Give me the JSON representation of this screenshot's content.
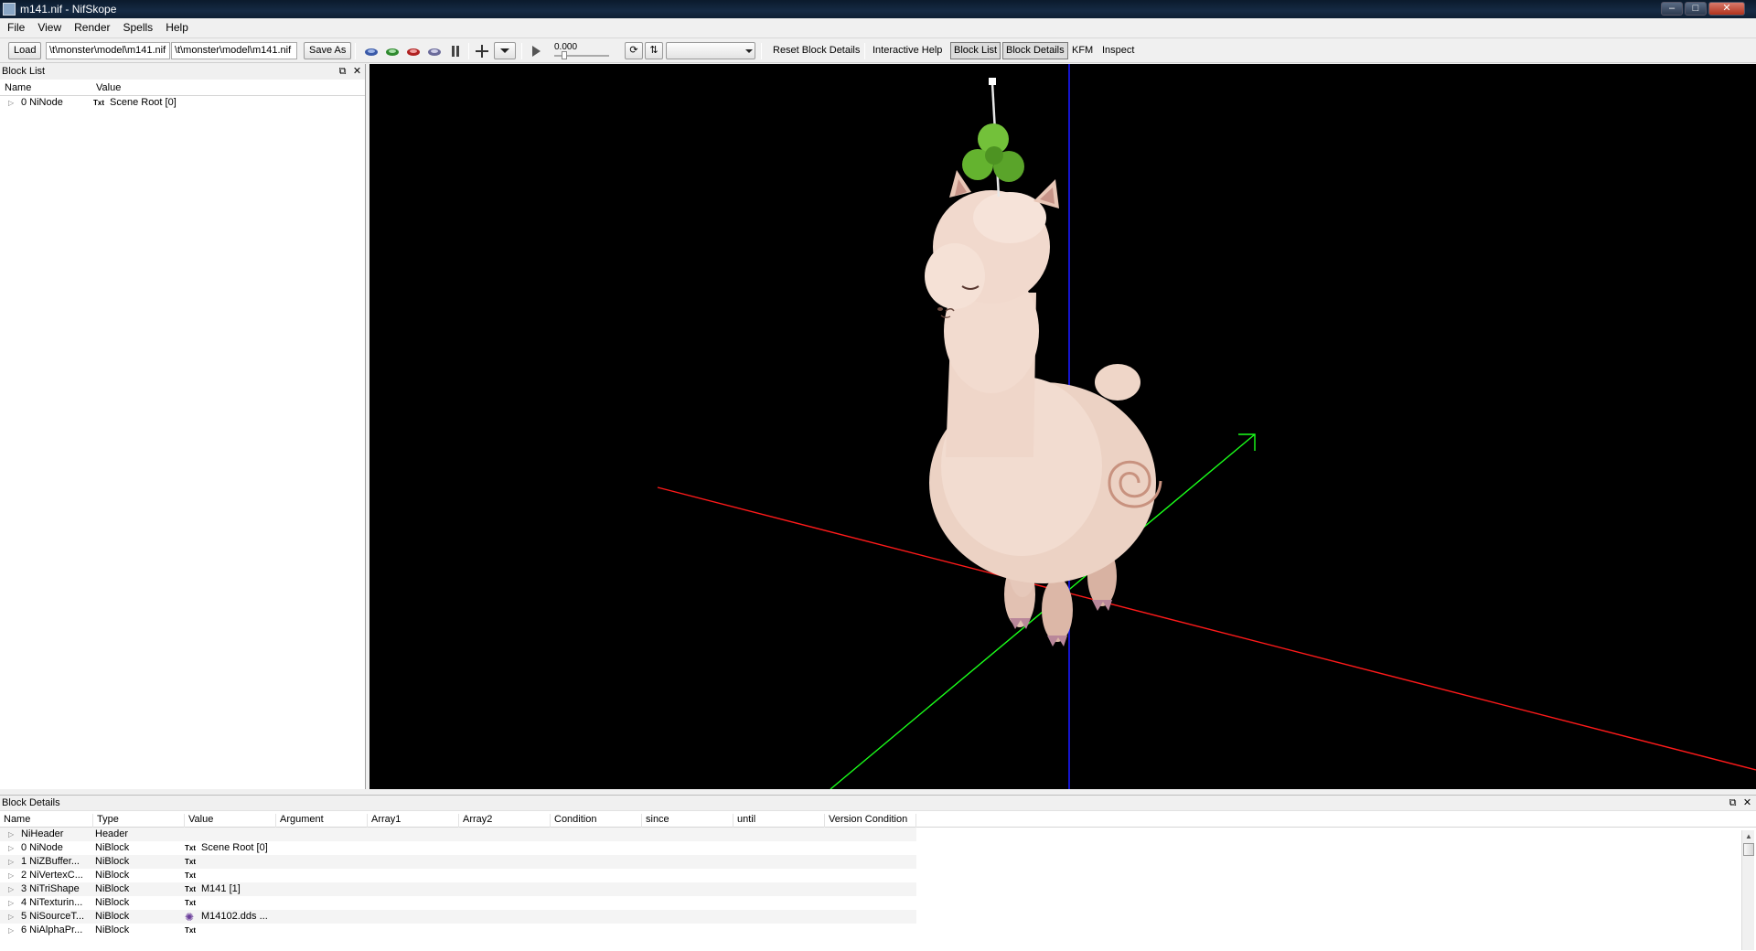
{
  "window": {
    "title": "m141.nif - NifSkope",
    "minimize": "–",
    "maximize": "□",
    "close": "✕"
  },
  "menu": [
    "File",
    "View",
    "Render",
    "Spells",
    "Help"
  ],
  "toolbar": {
    "load_label": "Load",
    "load_path": "\\t\\monster\\model\\m141.nif",
    "save_path": "\\t\\monster\\model\\m141.nif",
    "save_as_label": "Save As",
    "time_value": "0.000",
    "reset_block_details": "Reset Block Details",
    "interactive_help": "Interactive Help",
    "block_list": "Block List",
    "block_details": "Block Details",
    "kfm": "KFM",
    "inspect": "Inspect"
  },
  "block_list": {
    "title": "Block List",
    "col_name": "Name",
    "col_value": "Value",
    "rows": [
      {
        "name": "0 NiNode",
        "value": "Scene Root [0]"
      }
    ]
  },
  "block_details": {
    "title": "Block Details",
    "columns": [
      "Name",
      "Type",
      "Value",
      "Argument",
      "Array1",
      "Array2",
      "Condition",
      "since",
      "until",
      "Version Condition"
    ],
    "rows": [
      {
        "name": "NiHeader",
        "type": "Header",
        "value": "",
        "txt": ""
      },
      {
        "name": "0 NiNode",
        "type": "NiBlock",
        "value": "Scene Root [0]",
        "txt": "Txt"
      },
      {
        "name": "1 NiZBuffer...",
        "type": "NiBlock",
        "value": "",
        "txt": "Txt"
      },
      {
        "name": "2 NiVertexC...",
        "type": "NiBlock",
        "value": "",
        "txt": "Txt"
      },
      {
        "name": "3 NiTriShape",
        "type": "NiBlock",
        "value": "M141 [1]",
        "txt": "Txt"
      },
      {
        "name": "4 NiTexturin...",
        "type": "NiBlock",
        "value": "",
        "txt": "Txt"
      },
      {
        "name": "5 NiSourceT...",
        "type": "NiBlock",
        "value": "M14102.dds ...",
        "txt": ""
      },
      {
        "name": "6 NiAlphaPr...",
        "type": "NiBlock",
        "value": "",
        "txt": "Txt"
      }
    ]
  },
  "colors": {
    "x_axis": "#ff1a1a",
    "y_axis": "#1aff1a",
    "z_axis": "#1a1aff",
    "viewport_bg": "#000000"
  },
  "icons": [
    "app-icon",
    "texture-icon",
    "play-icon",
    "loop-icon",
    "dock-float-icon",
    "close-icon"
  ]
}
